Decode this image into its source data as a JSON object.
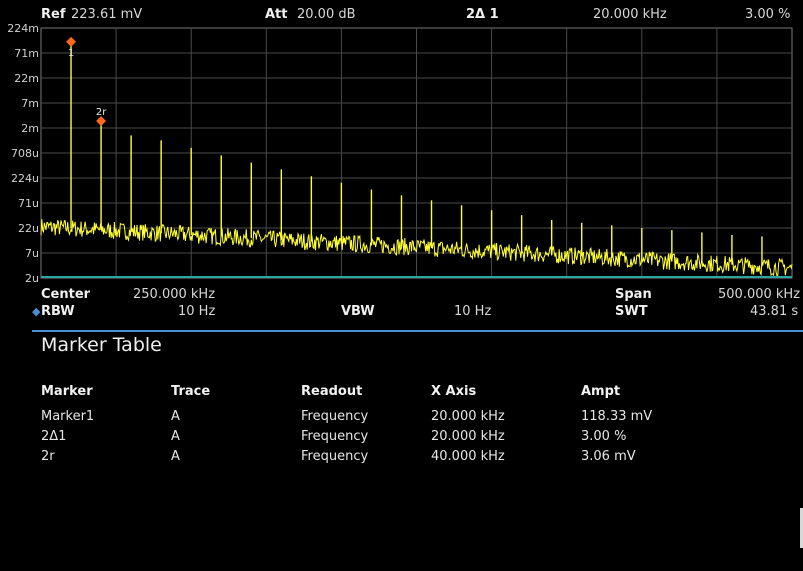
{
  "header": {
    "ref_label": "Ref",
    "ref_value": "223.61 mV",
    "att_label": "Att",
    "att_value": "20.00 dB",
    "marker_label": "2Δ 1",
    "marker_x": "20.000 kHz",
    "marker_y": "3.00 %"
  },
  "footer": {
    "center_label": "Center",
    "center_value": "250.000 kHz",
    "span_label": "Span",
    "span_value": "500.000 kHz",
    "rbw_label": "RBW",
    "rbw_value": "10 Hz",
    "vbw_label": "VBW",
    "vbw_value": "10 Hz",
    "swt_label": "SWT",
    "swt_value": "43.81 s"
  },
  "marker_table": {
    "title": "Marker Table",
    "columns": [
      "Marker",
      "Trace",
      "Readout",
      "X Axis",
      "Ampt"
    ],
    "rows": [
      [
        "Marker1",
        "A",
        "Frequency",
        "20.000 kHz",
        "118.33 mV"
      ],
      [
        "2Δ1",
        "A",
        "Frequency",
        "20.000 kHz",
        "3.00 %"
      ],
      [
        "2r",
        "A",
        "Frequency",
        "40.000 kHz",
        "3.06 mV"
      ]
    ]
  },
  "colors": {
    "trace": "#ffff33",
    "grid": "#4a4a4a",
    "marker": "#ff6a1a",
    "accent": "#4a8fd6",
    "baseline": "#2aa8a0"
  },
  "chart_data": {
    "type": "line",
    "y_scale": "log",
    "y_tick_labels": [
      "224m",
      "71m",
      "22m",
      "7m",
      "2m",
      "708u",
      "224u",
      "71u",
      "22u",
      "7u",
      "2u"
    ],
    "x_range_khz": [
      0,
      500
    ],
    "harmonic_frequencies_khz": [
      20,
      40,
      60,
      80,
      100,
      120,
      140,
      160,
      180,
      200,
      220,
      240,
      260,
      280,
      300,
      320,
      340,
      360,
      380,
      400,
      420,
      440,
      460,
      480
    ],
    "harmonic_peak_levels_v": [
      0.11833,
      0.00306,
      0.00158,
      0.00126,
      0.00089,
      0.00063,
      0.00045,
      0.00033,
      0.00024,
      0.000178,
      0.00013,
      0.0001,
      7.9e-05,
      6.3e-05,
      5e-05,
      4e-05,
      3.2e-05,
      2.8e-05,
      2.5e-05,
      2.2e-05,
      2e-05,
      1.8e-05,
      1.6e-05,
      1.5e-05
    ],
    "noise_floor_v": {
      "start": 2.35e-05,
      "end": 3.5e-06
    },
    "markers": [
      {
        "label": "1",
        "freq_khz": 20,
        "level_v": 0.11833
      },
      {
        "label": "2r",
        "freq_khz": 40,
        "level_v": 0.00306
      }
    ],
    "grid": true
  }
}
